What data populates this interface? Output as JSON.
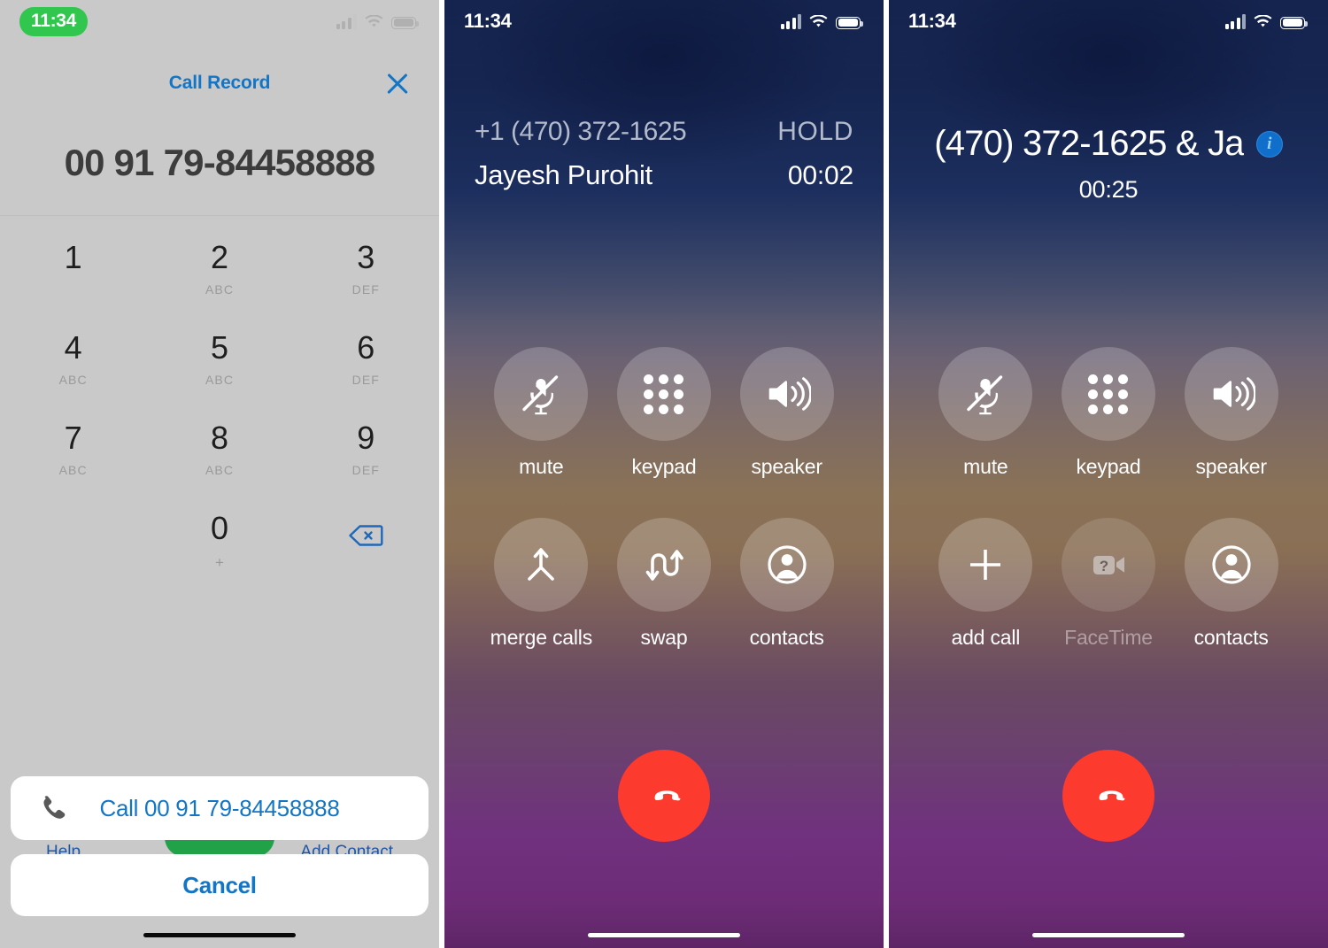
{
  "status_bar": {
    "time": "11:34",
    "signal_icon": "cellular-bars-icon",
    "wifi_icon": "wifi-icon",
    "battery_icon": "battery-icon"
  },
  "colors": {
    "ios_blue": "#1275c6",
    "green_pill": "#31c74f",
    "green_call": "#21a148",
    "end_call_red": "#fc3a2e",
    "info_blue": "#0f6fcb",
    "keypad_bg": "#c9c9c9",
    "dial_number": "#3c3c3c"
  },
  "panel1_dialer": {
    "title": "Call Record",
    "close_icon": "close-x-icon",
    "entered_number": "00 91 79-84458888",
    "keys": [
      {
        "digit": "1",
        "letters": ""
      },
      {
        "digit": "2",
        "letters": "ABC"
      },
      {
        "digit": "3",
        "letters": "DEF"
      },
      {
        "digit": "4",
        "letters": "ABC"
      },
      {
        "digit": "5",
        "letters": "ABC"
      },
      {
        "digit": "6",
        "letters": "DEF"
      },
      {
        "digit": "7",
        "letters": "ABC"
      },
      {
        "digit": "8",
        "letters": "ABC"
      },
      {
        "digit": "9",
        "letters": "DEF"
      },
      {
        "digit": "0",
        "letters": "+"
      }
    ],
    "backspace_icon": "backspace-delete-icon",
    "help_link": "Help",
    "add_contact_link": "Add Contact",
    "call_action": {
      "icon": "phone-handset-icon",
      "label": "Call 00 91 79-84458888"
    },
    "cancel_label": "Cancel"
  },
  "panel2_incall": {
    "phone_number": "+1 (470) 372-1625",
    "hold_label": "HOLD",
    "contact_name": "Jayesh Purohit",
    "timer": "00:02",
    "controls": [
      {
        "label": "mute",
        "icon": "mic-muted-icon",
        "disabled": false
      },
      {
        "label": "keypad",
        "icon": "keypad-dots-icon",
        "disabled": false
      },
      {
        "label": "speaker",
        "icon": "speaker-icon",
        "disabled": false
      },
      {
        "label": "merge calls",
        "icon": "merge-arrow-icon",
        "disabled": false
      },
      {
        "label": "swap",
        "icon": "swap-arrows-icon",
        "disabled": false
      },
      {
        "label": "contacts",
        "icon": "contacts-person-icon",
        "disabled": false
      }
    ],
    "end_call_icon": "end-call-handset-icon"
  },
  "panel3_merged": {
    "title": "(470) 372-1625 & Ja",
    "info_icon": "info-circle-icon",
    "info_glyph": "i",
    "timer": "00:25",
    "controls": [
      {
        "label": "mute",
        "icon": "mic-muted-icon",
        "disabled": false
      },
      {
        "label": "keypad",
        "icon": "keypad-dots-icon",
        "disabled": false
      },
      {
        "label": "speaker",
        "icon": "speaker-icon",
        "disabled": false
      },
      {
        "label": "add call",
        "icon": "plus-icon",
        "disabled": false
      },
      {
        "label": "FaceTime",
        "icon": "facetime-video-unavailable-icon",
        "disabled": true
      },
      {
        "label": "contacts",
        "icon": "contacts-person-icon",
        "disabled": false
      }
    ],
    "end_call_icon": "end-call-handset-icon"
  }
}
